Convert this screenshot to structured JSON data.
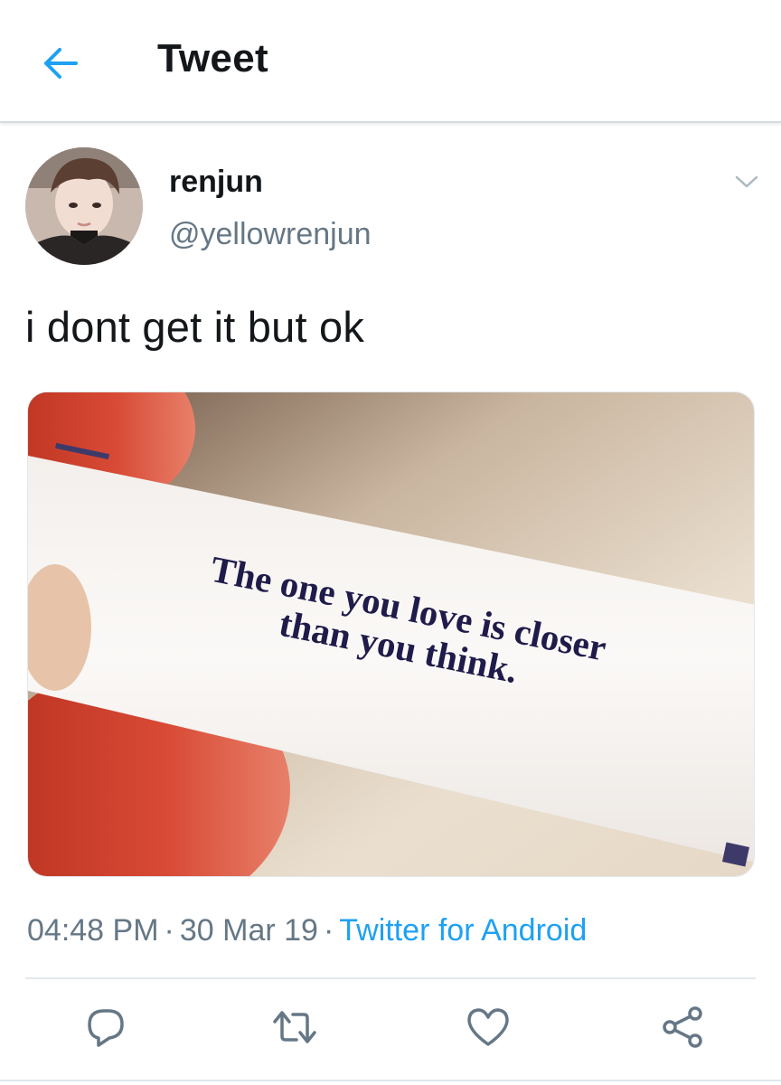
{
  "header": {
    "title": "Tweet",
    "back_icon": "arrow-left-icon"
  },
  "tweet": {
    "author": {
      "name": "renjun",
      "handle": "@yellowrenjun"
    },
    "text": "i dont get it but ok",
    "media": {
      "line1": "The one you love is closer",
      "line2": "than you think."
    },
    "timestamp": "04:48 PM",
    "date": "30 Mar 19",
    "separator": "·",
    "source": "Twitter for Android"
  },
  "actions": [
    {
      "name": "reply-icon"
    },
    {
      "name": "retweet-icon"
    },
    {
      "name": "like-icon"
    },
    {
      "name": "share-icon"
    }
  ],
  "colors": {
    "accent": "#1da1f2",
    "secondary_text": "#657786",
    "icon": "#657786",
    "divider": "#e1e8ed"
  }
}
